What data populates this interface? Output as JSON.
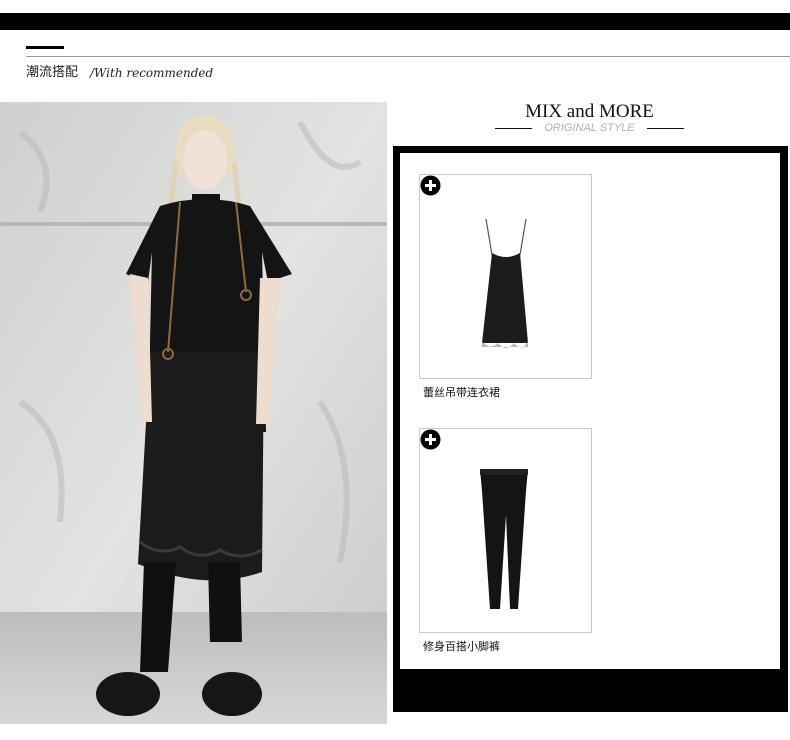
{
  "header": {
    "title": "潮流搭配",
    "subtitle": "/With recommended"
  },
  "photo": {
    "icon": "model-photo"
  },
  "mix": {
    "title": "MIX and MORE",
    "subtitle": "ORIGINAL STYLE"
  },
  "products": [
    {
      "name": "蕾丝吊带连衣裙",
      "icon": "slip-dress-image",
      "action_icon": "plus-circle-icon"
    },
    {
      "name": "修身百搭小脚裤",
      "icon": "skinny-pants-image",
      "action_icon": "plus-circle-icon"
    }
  ],
  "colors": {
    "bar": "#000000",
    "frame": "#000000",
    "subtitle_gray": "#b0b0b0",
    "card_border": "#c8c8c8"
  }
}
